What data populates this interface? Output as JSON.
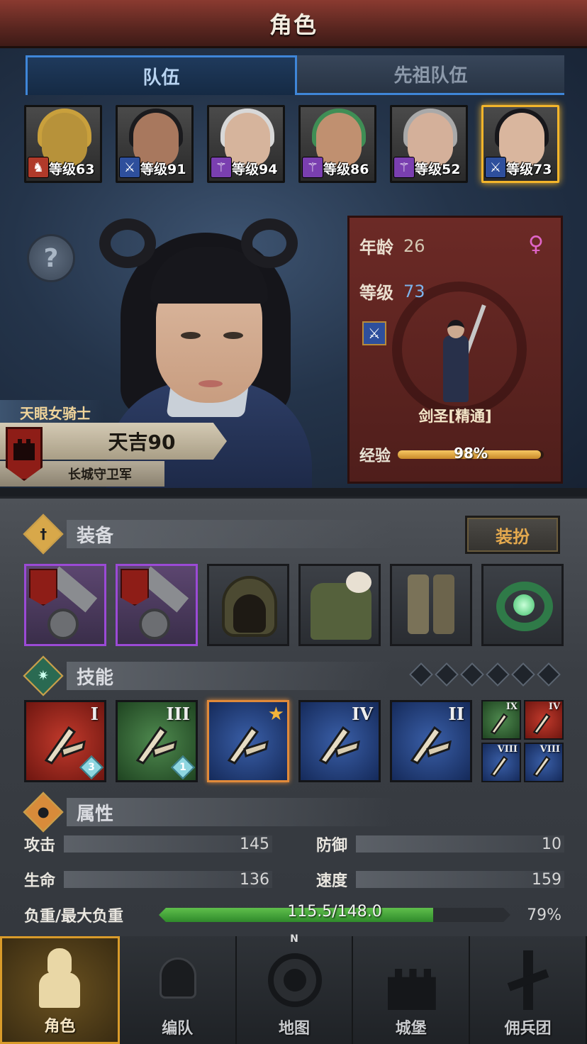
{
  "header": {
    "title": "角色"
  },
  "tabs": [
    {
      "label": "队伍",
      "active": true
    },
    {
      "label": "先祖队伍",
      "active": false
    }
  ],
  "roster": [
    {
      "level_text": "等级63",
      "class_icon": "warrior-helmet-icon",
      "badge_color": "#b03a2a",
      "hair": "#c9a03c",
      "skin": "#b7923a",
      "selected": false
    },
    {
      "level_text": "等级91",
      "class_icon": "sword-icon",
      "badge_color": "#2e4f9c",
      "hair": "#1b1b1e",
      "skin": "#a8785e",
      "selected": false
    },
    {
      "level_text": "等级94",
      "class_icon": "staff-icon",
      "badge_color": "#7a3fb0",
      "hair": "#d8d8d8",
      "skin": "#d6b49c",
      "selected": false
    },
    {
      "level_text": "等级86",
      "class_icon": "staff-icon",
      "badge_color": "#7a3fb0",
      "hair": "#3f8e55",
      "skin": "#c09070",
      "selected": false
    },
    {
      "level_text": "等级52",
      "class_icon": "staff-icon",
      "badge_color": "#7a3fb0",
      "hair": "#a9a9a9",
      "skin": "#d4b09a",
      "selected": false
    },
    {
      "level_text": "等级73",
      "class_icon": "sword-icon",
      "badge_color": "#2e4f9c",
      "hair": "#17171b",
      "skin": "#d9b69e",
      "selected": true
    }
  ],
  "character": {
    "title": "天眼女骑士",
    "name": "天吉90",
    "guild": "长城守卫军",
    "age_label": "年龄",
    "age": "26",
    "gender_icon": "female-symbol-icon",
    "gender_symbol": "♀",
    "level_label": "等级",
    "level": "73",
    "job": "剑圣[精通]",
    "exp_label": "经验",
    "exp_percent": 98,
    "exp_text": "98%"
  },
  "equipment": {
    "section_label": "装备",
    "dress_button": "装扮",
    "slots": [
      {
        "name": "greatsword-slot-1",
        "rarity": "epic",
        "crest": true
      },
      {
        "name": "greatsword-slot-2",
        "rarity": "epic",
        "crest": true
      },
      {
        "name": "hood-slot",
        "rarity": "common",
        "crest": false
      },
      {
        "name": "fur-tunic-slot",
        "rarity": "common",
        "crest": false
      },
      {
        "name": "boots-slot",
        "rarity": "common",
        "crest": false
      },
      {
        "name": "emerald-ring-slot",
        "rarity": "common",
        "crest": false
      }
    ]
  },
  "skills": {
    "section_label": "技能",
    "slot_dots": 6,
    "main": [
      {
        "color": "red",
        "roman": "I",
        "gem": "3",
        "star": false,
        "selected": false
      },
      {
        "color": "green",
        "roman": "III",
        "gem": "1",
        "star": false,
        "selected": false
      },
      {
        "color": "blue",
        "roman": "",
        "gem": "",
        "star": true,
        "selected": true
      },
      {
        "color": "blue",
        "roman": "IV",
        "gem": "",
        "star": false,
        "selected": false
      },
      {
        "color": "blue",
        "roman": "II",
        "gem": "",
        "star": false,
        "selected": false
      }
    ],
    "small": [
      {
        "color": "green",
        "roman": "IX"
      },
      {
        "color": "red",
        "roman": "IV"
      },
      {
        "color": "blue",
        "roman": "VIII"
      },
      {
        "color": "blue",
        "roman": "VIII"
      }
    ]
  },
  "attributes": {
    "section_label": "属性",
    "attack_label": "攻击",
    "attack": "145",
    "defense_label": "防御",
    "defense": "10",
    "hp_label": "生命",
    "hp": "136",
    "speed_label": "速度",
    "speed": "159",
    "load_label": "负重/最大负重",
    "load_text": "115.5/148.0",
    "load_fraction": 0.78,
    "load_percent": "79%"
  },
  "nav": [
    {
      "label": "角色",
      "icon": "knight-icon",
      "active": true
    },
    {
      "label": "编队",
      "icon": "helmet-icon",
      "active": false
    },
    {
      "label": "地图",
      "icon": "compass-map-icon",
      "active": false,
      "compass_letter": "N"
    },
    {
      "label": "城堡",
      "icon": "castle-icon",
      "active": false
    },
    {
      "label": "佣兵团",
      "icon": "mercenary-banner-icon",
      "active": false
    }
  ],
  "colors": {
    "title_bar": "#5a2620",
    "tab_active_border": "#3f86d8",
    "selection_gold": "#f3b52b",
    "epic_purple": "#9b4ad6",
    "load_green": "#3fa33a",
    "exp_gold": "#e0a33a"
  }
}
